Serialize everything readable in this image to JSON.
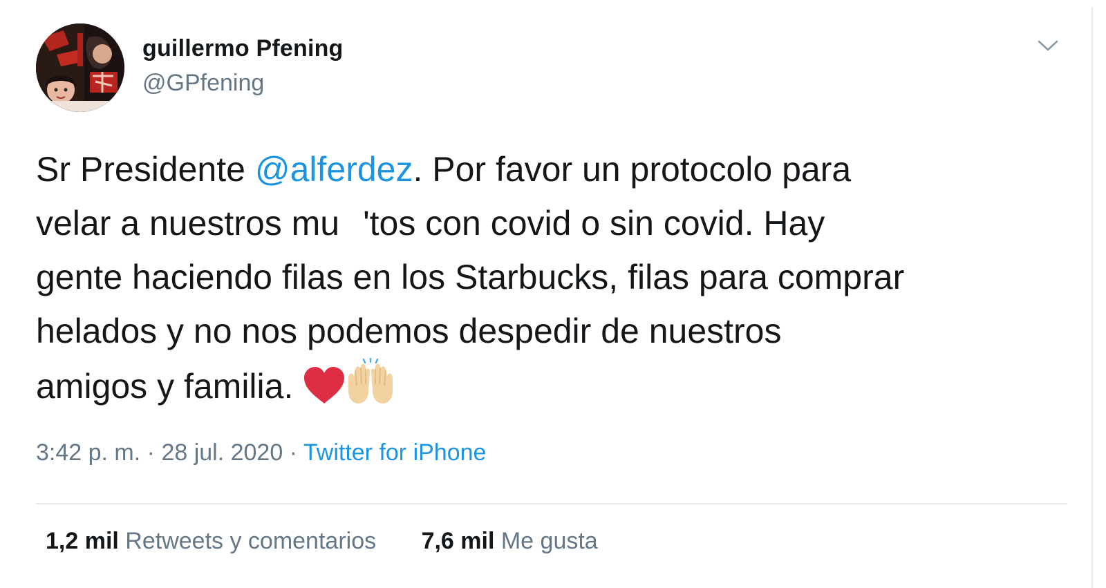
{
  "author": {
    "display_name": "guillermo Pfening",
    "handle": "@GPfening",
    "avatar_icon": "profile-photo"
  },
  "menu": {
    "icon": "chevron-down-icon"
  },
  "tweet": {
    "lines": [
      {
        "parts": [
          {
            "type": "text",
            "value": "Sr Presidente "
          },
          {
            "type": "mention",
            "value": "@alferdez"
          },
          {
            "type": "text",
            "value": ". Por favor un protocolo para"
          }
        ]
      },
      {
        "parts": [
          {
            "type": "text",
            "value": "velar a nuestros mu"
          },
          {
            "type": "gap"
          },
          {
            "type": "text",
            "value": "'tos con covid o sin covid. Hay"
          }
        ]
      },
      {
        "parts": [
          {
            "type": "text",
            "value": "gente haciendo filas en los Starbucks, filas para comprar"
          }
        ]
      },
      {
        "parts": [
          {
            "type": "text",
            "value": "helados y no nos podemos despedir de nuestros"
          }
        ]
      },
      {
        "parts": [
          {
            "type": "text",
            "value": "amigos y familia. "
          },
          {
            "type": "emoji",
            "value": "red-heart"
          },
          {
            "type": "emoji",
            "value": "raising-hands"
          }
        ]
      }
    ]
  },
  "meta": {
    "time": "3:42 p. m.",
    "separator": "·",
    "date": "28 jul. 2020",
    "source": "Twitter for iPhone"
  },
  "stats": {
    "retweets_count": "1,2 mil",
    "retweets_label": "Retweets y comentarios",
    "likes_count": "7,6 mil",
    "likes_label": "Me gusta"
  },
  "colors": {
    "text": "#14171a",
    "secondary": "#657786",
    "link": "#1b95e0",
    "divider": "#e6ecf0",
    "heart": "#dd2e44",
    "hands": "#f3d2a2"
  }
}
